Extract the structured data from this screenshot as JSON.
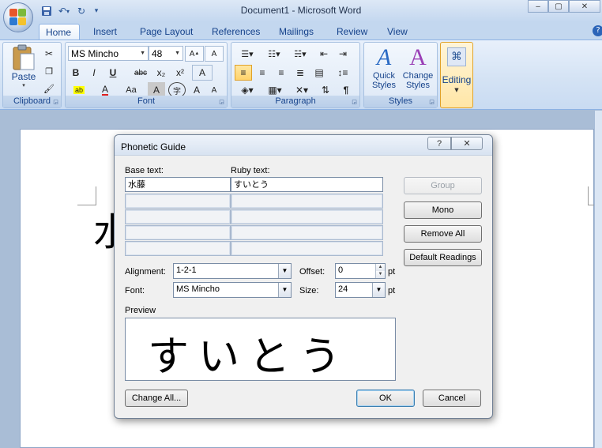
{
  "window": {
    "title": "Document1 - Microsoft Word",
    "controls": {
      "minimize": "‒",
      "maximize": "▢",
      "close": "✕"
    }
  },
  "qat": {
    "save": "💾",
    "undo": "↶",
    "undo_arrow": "▾",
    "redo": "↻",
    "customize": "▾"
  },
  "tabs": [
    "Home",
    "Insert",
    "Page Layout",
    "References",
    "Mailings",
    "Review",
    "View"
  ],
  "help_icon": "?",
  "ribbon": {
    "clipboard": {
      "label": "Clipboard",
      "paste_label": "Paste",
      "paste_arrow": "▾"
    },
    "font": {
      "label": "Font",
      "font_name": "MS Mincho",
      "font_size": "48",
      "bold": "B",
      "italic": "I",
      "underline": "U",
      "strike": "abc",
      "subscript": "x₂",
      "superscript": "x²",
      "change_case": "Aa",
      "grow": "A",
      "shrink": "A",
      "char_shading": "A",
      "enclose": "字",
      "clear": "A",
      "phonetic": "A"
    },
    "paragraph": {
      "label": "Paragraph",
      "pilcrow": "¶"
    },
    "styles": {
      "label": "Styles",
      "quick_styles": "Quick\nStyles",
      "change_styles": "Change\nStyles"
    },
    "editing": {
      "label": "Editing"
    }
  },
  "dialog": {
    "title": "Phonetic Guide",
    "help": "?",
    "close": "✕",
    "base_text_label": "Base text:",
    "ruby_text_label": "Ruby text:",
    "base_text": "水藤",
    "ruby_text": "すいとう",
    "buttons": {
      "group": "Group",
      "mono": "Mono",
      "remove_all": "Remove All",
      "default_readings": "Default Readings",
      "change_all": "Change All...",
      "ok": "OK",
      "cancel": "Cancel"
    },
    "alignment_label": "Alignment:",
    "alignment_value": "1-2-1",
    "offset_label": "Offset:",
    "offset_value": "0",
    "offset_unit": "pt",
    "font_label": "Font:",
    "font_value": "MS Mincho",
    "size_label": "Size:",
    "size_value": "24",
    "size_unit": "pt",
    "preview_label": "Preview",
    "preview_text": "すいとう"
  },
  "document": {
    "partial_glyph": "水"
  }
}
